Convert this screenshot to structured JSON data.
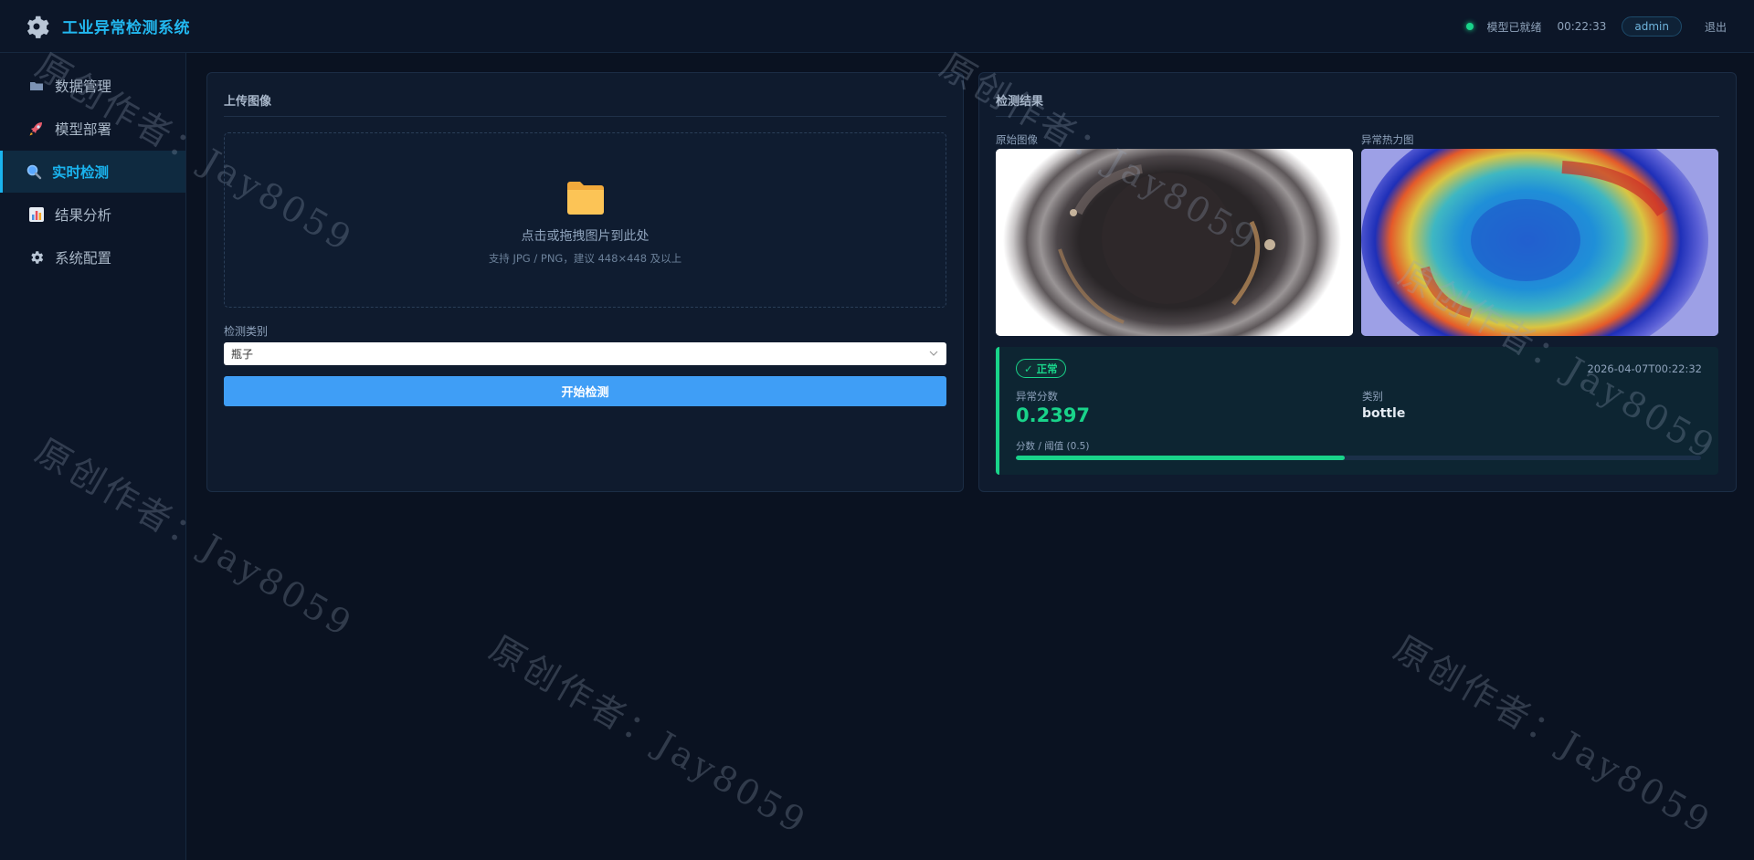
{
  "app": {
    "title": "工业异常检测系统",
    "brand_icon": "gear-icon"
  },
  "header": {
    "status_text": "模型已就绪",
    "status_color": "#19d38a",
    "clock": "00:22:33",
    "user": "admin",
    "logout_label": "退出"
  },
  "sidebar": {
    "items": [
      {
        "label": "数据管理",
        "icon": "folder-icon",
        "active": false
      },
      {
        "label": "模型部署",
        "icon": "rocket-icon",
        "active": false
      },
      {
        "label": "实时检测",
        "icon": "magnifier-icon",
        "active": true
      },
      {
        "label": "结果分析",
        "icon": "bar-chart-icon",
        "active": false
      },
      {
        "label": "系统配置",
        "icon": "gear-icon",
        "active": false
      }
    ]
  },
  "upload": {
    "title": "上传图像",
    "dropzone_main": "点击或拖拽图片到此处",
    "dropzone_sub": "支持 JPG / PNG，建议 448×448 及以上",
    "category_label": "检测类别",
    "category_value": "瓶子",
    "start_label": "开始检测",
    "accent_color": "#3f9ef6"
  },
  "result": {
    "title": "检测结果",
    "original_label": "原始图像",
    "heatmap_label": "异常热力图",
    "status_badge": "✓ 正常",
    "timestamp": "2026-04-07T00:22:32",
    "score_label": "异常分数",
    "score_value": "0.2397",
    "category_label": "类别",
    "category_value": "bottle",
    "bar_label": "分数 / 阈值 (0.5)",
    "bar_fraction": 0.4794,
    "ok_color": "#19d38a"
  },
  "watermark": {
    "text": "原创作者：Jay8059"
  }
}
